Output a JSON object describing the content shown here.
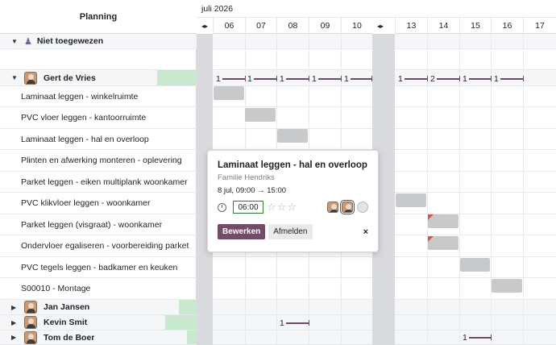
{
  "header": {
    "column_title": "Planning",
    "month": "juli 2026",
    "days": [
      "06",
      "07",
      "08",
      "09",
      "10",
      "13",
      "14",
      "15",
      "16",
      "17"
    ],
    "weekend_toggle": "◂▸"
  },
  "groups": {
    "unassigned": "Niet toegewezen",
    "gert": "Gert de Vries",
    "jan": "Jan Jansen",
    "kevin": "Kevin Smit",
    "tom": "Tom de Boer"
  },
  "tasks": [
    "Laminaat leggen - winkelruimte",
    "PVC vloer leggen - kantoorruimte",
    "Laminaat leggen - hal en overloop",
    "Plinten en afwerking monteren - oplevering",
    "Parket leggen - eiken multiplank woonkamer",
    "PVC klikvloer leggen - woonkamer",
    "Parket leggen (visgraat) - woonkamer",
    "Ondervloer egaliseren - voorbereiding parket",
    "PVC tegels leggen - badkamer en keuken",
    "S00010 - Montage"
  ],
  "gert_loads": [
    "1",
    "1",
    "1",
    "1",
    "1",
    "1",
    "2",
    "1",
    "1"
  ],
  "kevin_loads": [
    "1"
  ],
  "tom_loads": [
    "1"
  ],
  "popover": {
    "title": "Laminaat leggen - hal en overloop",
    "customer": "Familie Hendriks",
    "time_range": "8 jul, 09:00 → 15:00",
    "hours": "06:00",
    "stars": "☆☆☆",
    "edit_label": "Bewerken",
    "unsubscribe_label": "Afmelden",
    "close_label": "×"
  },
  "colors": {
    "accent": "#714b67",
    "load_line": "#6d4a66",
    "weekend": "#d9dadd",
    "pill": "#c8c9cb",
    "green_load": "#c9e9cf",
    "warning_corner": "#d9534f"
  }
}
